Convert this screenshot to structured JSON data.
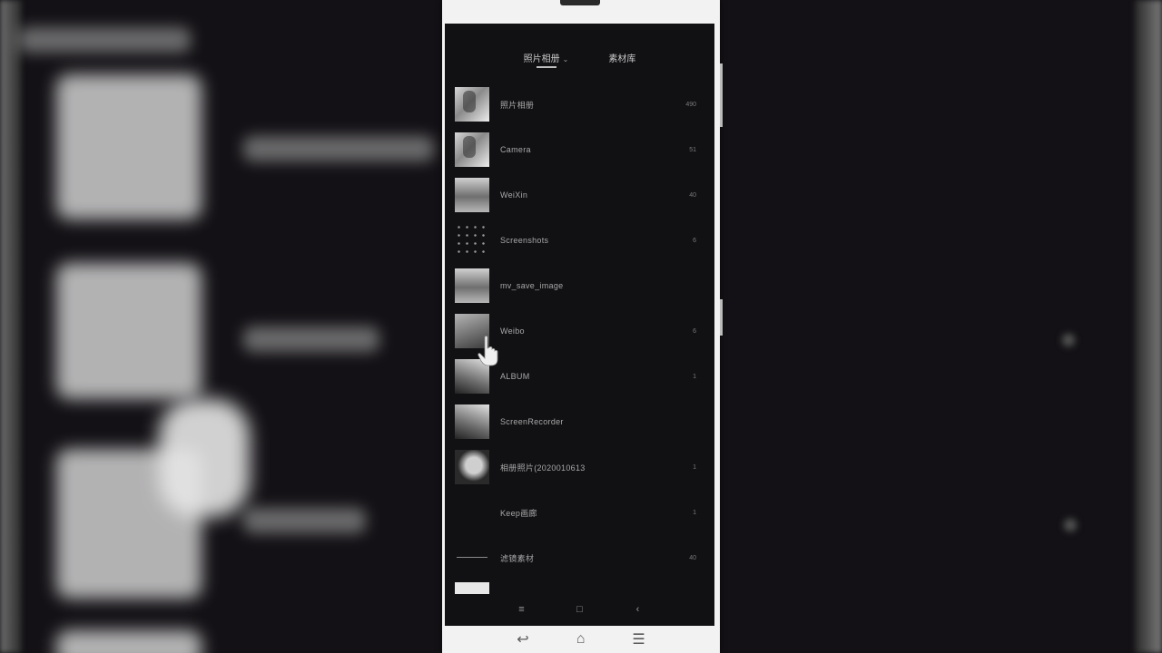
{
  "tabs": [
    {
      "label": "照片相册",
      "active": true,
      "has_dropdown": true
    },
    {
      "label": "素材库",
      "active": false
    }
  ],
  "albums": [
    {
      "name": "照片相册",
      "count": "490",
      "thumb": "face"
    },
    {
      "name": "Camera",
      "count": "51",
      "thumb": "face"
    },
    {
      "name": "WeiXin",
      "count": "40",
      "thumb": "landscape"
    },
    {
      "name": "Screenshots",
      "count": "6",
      "thumb": "dots"
    },
    {
      "name": "mv_save_image",
      "count": "",
      "thumb": "landscape"
    },
    {
      "name": "Weibo",
      "count": "6",
      "thumb": "dark"
    },
    {
      "name": "ALBUM",
      "count": "1",
      "thumb": "sketch"
    },
    {
      "name": "ScreenRecorder",
      "count": "",
      "thumb": "sketch"
    },
    {
      "name": "相册照片(2020010613",
      "count": "1",
      "thumb": "portrait"
    },
    {
      "name": "Keep画廊",
      "count": "1",
      "thumb": "empty"
    },
    {
      "name": "滤镜素材",
      "count": "40",
      "thumb": "line"
    }
  ],
  "nav": {
    "menu_icon": "≡",
    "home_icon": "□",
    "back_icon": "‹"
  },
  "device_keys": {
    "back": "↩",
    "home": "⌂",
    "menu": "☰"
  }
}
